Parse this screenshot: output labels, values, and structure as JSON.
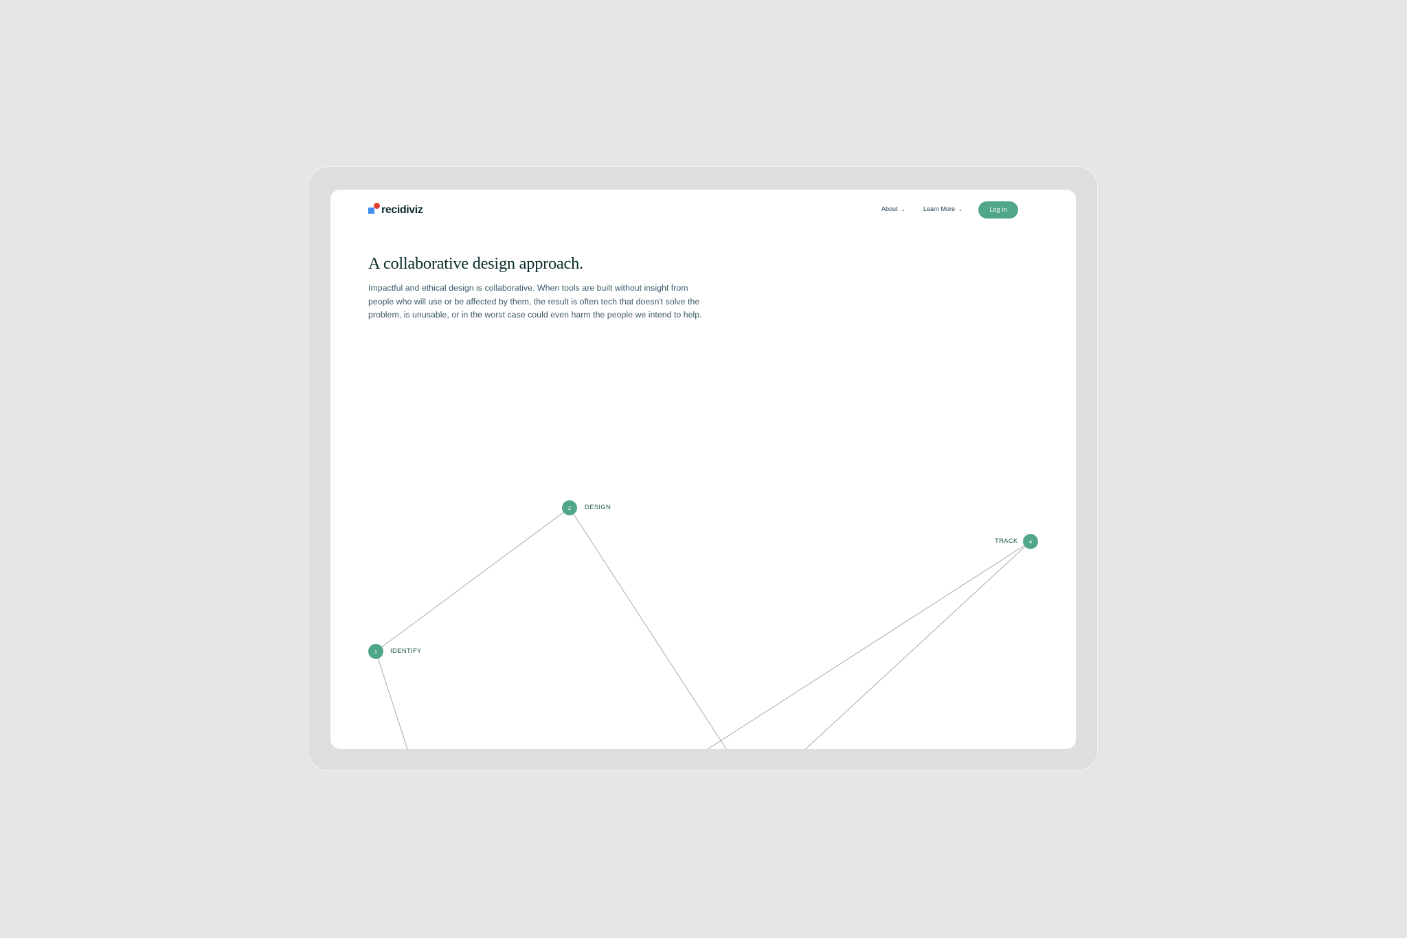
{
  "brand": {
    "name": "recidiviz",
    "mark_colors": [
      "#3f8ef0",
      "#e0402f"
    ]
  },
  "nav": {
    "items": [
      {
        "label": "About"
      },
      {
        "label": "Learn More"
      }
    ],
    "login_label": "Log In"
  },
  "hero": {
    "title": "A collaborative design approach.",
    "body": "Impactful and ethical design is collaborative. When tools are built without insight from people who will use or be affected by them, the result is often tech that doesn't solve the problem, is unusable, or in the worst case could even harm the people we intend to help."
  },
  "process": {
    "accent_color": "#50a68a",
    "steps": [
      {
        "number": "1",
        "label": "IDENTIFY"
      },
      {
        "number": "2",
        "label": "DESIGN"
      },
      {
        "number": "4",
        "label": "TRACK"
      }
    ]
  }
}
